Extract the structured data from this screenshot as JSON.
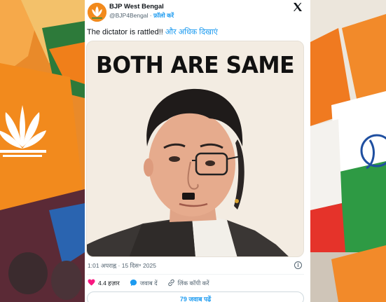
{
  "account": {
    "name": "BJP West Bengal",
    "handle": "@BJP4Bengal",
    "separator": "·",
    "follow_label": "फ़ॉलो करें"
  },
  "tweet": {
    "text": "The dictator is rattled!!",
    "show_more": "और अधिक दिखाएं",
    "image_headline": "BOTH ARE SAME",
    "timestamp": "1:01 अपराह्न · 15 दिस॰ 2025"
  },
  "actions": {
    "likes": "4.4 हज़ार",
    "reply_label": "जवाब दें",
    "copy_link_label": "लिंक कॉपी करें"
  },
  "replies_button": "79 जवाब पढ़ें",
  "colors": {
    "accent": "#1d9bf0",
    "like": "#f91880",
    "saffron": "#f28a1d",
    "green": "#1f8a3a"
  },
  "icons": [
    "x-logo-icon",
    "info-icon",
    "heart-icon",
    "reply-icon",
    "link-icon",
    "lotus-icon"
  ]
}
